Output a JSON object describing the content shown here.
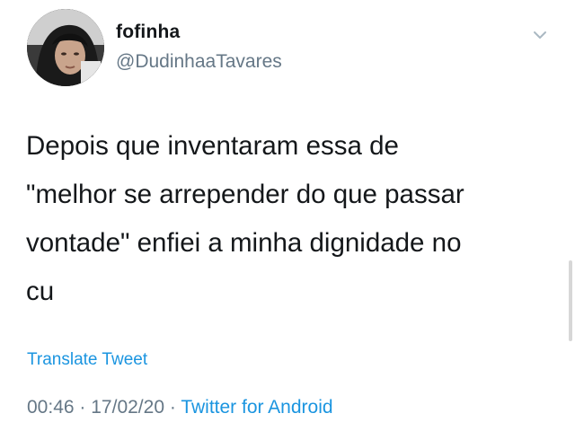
{
  "tweet": {
    "display_name": "fofinha",
    "handle": "@DudinhaaTavares",
    "text": "Depois que inventaram essa de\n\"melhor se arrepender do que passar\nvontade\" enfiei a minha dignidade no\ncu",
    "translate_label": "Translate Tweet",
    "time": "00:46",
    "separator": "·",
    "date": "17/02/20",
    "source": "Twitter for Android"
  },
  "icons": {
    "menu_caret": "chevron-down-icon"
  },
  "colors": {
    "text_primary": "#14171a",
    "text_secondary": "#657786",
    "link": "#1b95e0",
    "background": "#ffffff"
  }
}
